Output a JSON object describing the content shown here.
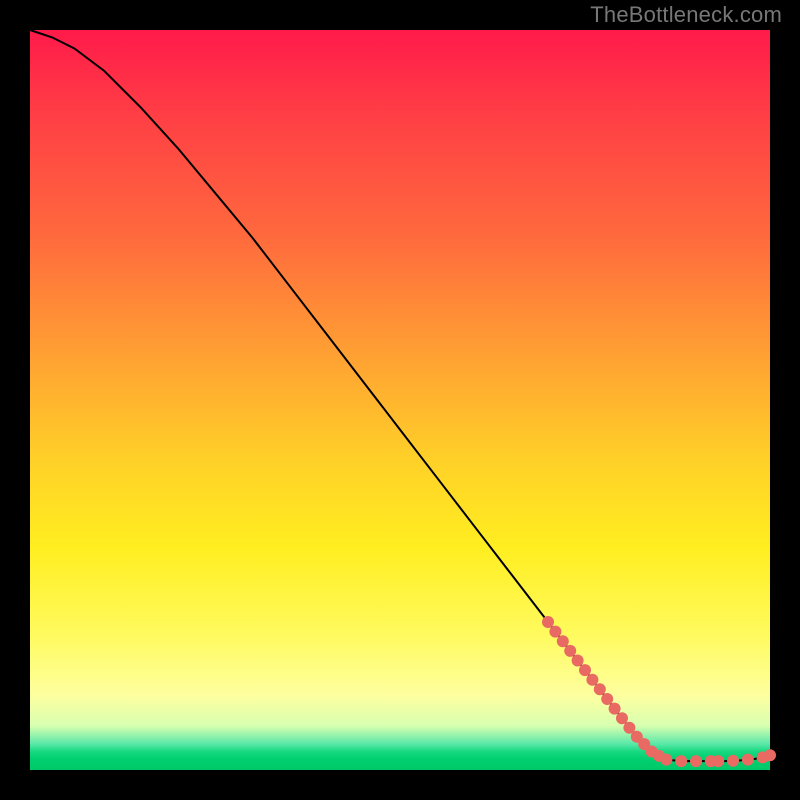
{
  "watermark": "TheBottleneck.com",
  "colors": {
    "line": "#000000",
    "dot": "#e86a62",
    "gradient_stops": [
      "#ff1a4a",
      "#ff3a46",
      "#ff6a3d",
      "#ff9a34",
      "#ffd028",
      "#ffee20",
      "#fffb60",
      "#fdffa0",
      "#d8ffb0",
      "#58e8a8",
      "#18d880",
      "#00d070",
      "#00c868"
    ]
  },
  "chart_data": {
    "type": "line",
    "title": "",
    "xlabel": "",
    "ylabel": "",
    "xlim": [
      0,
      100
    ],
    "ylim": [
      0,
      100
    ],
    "series": [
      {
        "name": "curve",
        "x": [
          0,
          3,
          6,
          10,
          15,
          20,
          25,
          30,
          35,
          40,
          45,
          50,
          55,
          60,
          65,
          70,
          75,
          80,
          82,
          84,
          86,
          88,
          90,
          92,
          94,
          96,
          98,
          100
        ],
        "y": [
          100,
          99,
          97.5,
          94.5,
          89.5,
          84,
          78,
          72,
          65.5,
          59,
          52.5,
          46,
          39.5,
          33,
          26.5,
          20,
          13.5,
          7,
          4.5,
          2.5,
          1.4,
          1.2,
          1.2,
          1.2,
          1.2,
          1.3,
          1.5,
          2.0
        ]
      }
    ],
    "scatter_on_curve": {
      "name": "highlight-dots",
      "x": [
        70,
        71,
        72,
        73,
        74,
        75,
        76,
        77,
        78,
        79,
        80,
        81,
        82,
        83,
        84,
        85,
        86,
        88,
        90,
        92,
        93,
        95,
        97,
        99,
        100
      ],
      "y": [
        20,
        18.7,
        17.4,
        16.1,
        14.8,
        13.5,
        12.2,
        10.9,
        9.6,
        8.3,
        7,
        5.7,
        4.5,
        3.5,
        2.5,
        1.9,
        1.4,
        1.2,
        1.2,
        1.2,
        1.2,
        1.25,
        1.4,
        1.7,
        2.0
      ]
    }
  }
}
